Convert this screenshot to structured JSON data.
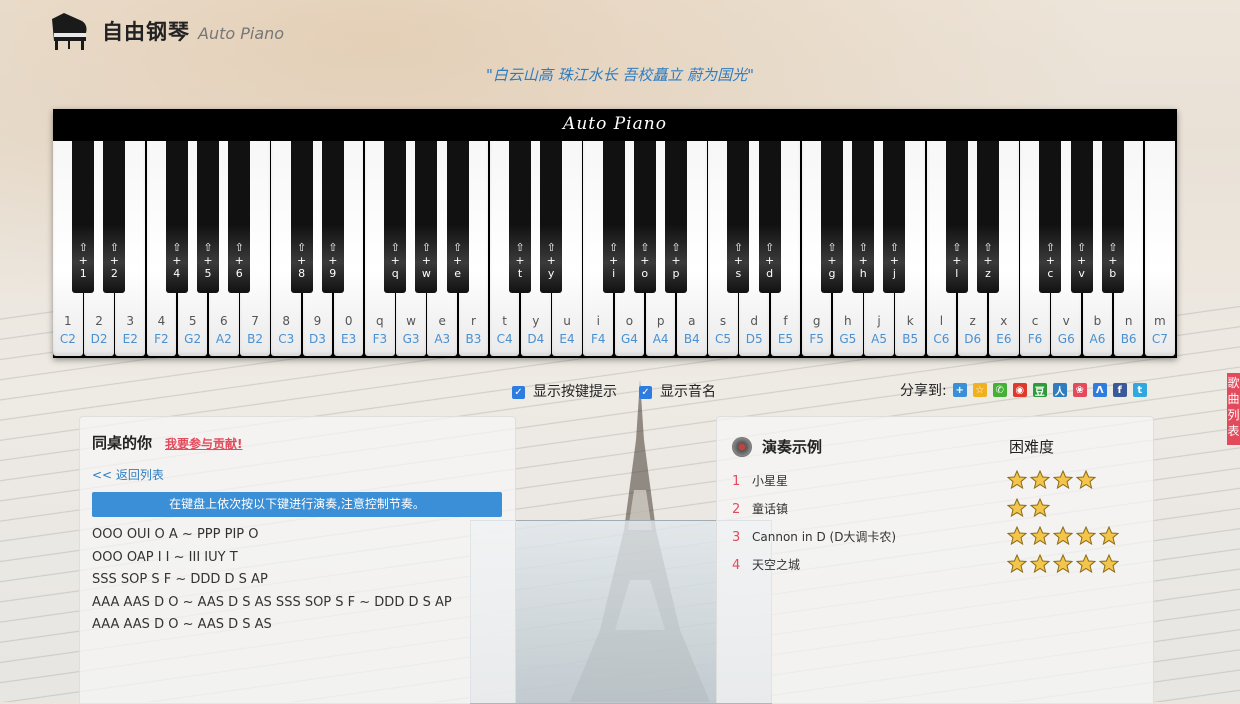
{
  "header": {
    "title": "自由钢琴",
    "subtitle": "Auto Piano",
    "motto": "\"白云山高 珠江水长 吾校矗立 蔚为国光\""
  },
  "piano": {
    "brand": "Auto Piano",
    "white_keys": [
      {
        "char": "1",
        "note": "C2"
      },
      {
        "char": "2",
        "note": "D2"
      },
      {
        "char": "3",
        "note": "E2"
      },
      {
        "char": "4",
        "note": "F2"
      },
      {
        "char": "5",
        "note": "G2"
      },
      {
        "char": "6",
        "note": "A2"
      },
      {
        "char": "7",
        "note": "B2"
      },
      {
        "char": "8",
        "note": "C3"
      },
      {
        "char": "9",
        "note": "D3"
      },
      {
        "char": "0",
        "note": "E3"
      },
      {
        "char": "q",
        "note": "F3"
      },
      {
        "char": "w",
        "note": "G3"
      },
      {
        "char": "e",
        "note": "A3"
      },
      {
        "char": "r",
        "note": "B3"
      },
      {
        "char": "t",
        "note": "C4"
      },
      {
        "char": "y",
        "note": "D4"
      },
      {
        "char": "u",
        "note": "E4"
      },
      {
        "char": "i",
        "note": "F4"
      },
      {
        "char": "o",
        "note": "G4"
      },
      {
        "char": "p",
        "note": "A4"
      },
      {
        "char": "a",
        "note": "B4"
      },
      {
        "char": "s",
        "note": "C5"
      },
      {
        "char": "d",
        "note": "D5"
      },
      {
        "char": "f",
        "note": "E5"
      },
      {
        "char": "g",
        "note": "F5"
      },
      {
        "char": "h",
        "note": "G5"
      },
      {
        "char": "j",
        "note": "A5"
      },
      {
        "char": "k",
        "note": "B5"
      },
      {
        "char": "l",
        "note": "C6"
      },
      {
        "char": "z",
        "note": "D6"
      },
      {
        "char": "x",
        "note": "E6"
      },
      {
        "char": "c",
        "note": "F6"
      },
      {
        "char": "v",
        "note": "G6"
      },
      {
        "char": "b",
        "note": "A6"
      },
      {
        "char": "n",
        "note": "B6"
      },
      {
        "char": "m",
        "note": "C7"
      }
    ],
    "black_keys": [
      {
        "char": "1",
        "after_white": 0
      },
      {
        "char": "2",
        "after_white": 1
      },
      {
        "char": "4",
        "after_white": 3
      },
      {
        "char": "5",
        "after_white": 4
      },
      {
        "char": "6",
        "after_white": 5
      },
      {
        "char": "8",
        "after_white": 7
      },
      {
        "char": "9",
        "after_white": 8
      },
      {
        "char": "q",
        "after_white": 10
      },
      {
        "char": "w",
        "after_white": 11
      },
      {
        "char": "e",
        "after_white": 12
      },
      {
        "char": "t",
        "after_white": 14
      },
      {
        "char": "y",
        "after_white": 15
      },
      {
        "char": "i",
        "after_white": 17
      },
      {
        "char": "o",
        "after_white": 18
      },
      {
        "char": "p",
        "after_white": 19
      },
      {
        "char": "s",
        "after_white": 21
      },
      {
        "char": "d",
        "after_white": 22
      },
      {
        "char": "g",
        "after_white": 24
      },
      {
        "char": "h",
        "after_white": 25
      },
      {
        "char": "j",
        "after_white": 26
      },
      {
        "char": "l",
        "after_white": 28
      },
      {
        "char": "z",
        "after_white": 29
      },
      {
        "char": "c",
        "after_white": 31
      },
      {
        "char": "v",
        "after_white": 32
      },
      {
        "char": "b",
        "after_white": 33
      }
    ],
    "shift_symbol": "⇧",
    "plus_symbol": "+"
  },
  "options": {
    "show_key_hints_label": "显示按键提示",
    "show_key_hints_checked": true,
    "show_note_names_label": "显示音名",
    "show_note_names_checked": true,
    "checkmark": "✓"
  },
  "share": {
    "label": "分享到:",
    "icons": [
      {
        "name": "plus-share-icon",
        "color": "#3a8fd6",
        "glyph": "+"
      },
      {
        "name": "favorite-star-icon",
        "color": "#f0b020",
        "glyph": "☆"
      },
      {
        "name": "wechat-icon",
        "color": "#45b035",
        "glyph": "✆"
      },
      {
        "name": "weibo-icon",
        "color": "#e0382a",
        "glyph": "◉"
      },
      {
        "name": "douban-icon",
        "color": "#2f9a3c",
        "glyph": "豆"
      },
      {
        "name": "renren-icon",
        "color": "#2f7cc0",
        "glyph": "人"
      },
      {
        "name": "flower-icon",
        "color": "#e34a5c",
        "glyph": "❀"
      },
      {
        "name": "qzone-icon",
        "color": "#2f7ce0",
        "glyph": "Λ"
      },
      {
        "name": "facebook-icon",
        "color": "#3b5998",
        "glyph": "f"
      },
      {
        "name": "twitter-icon",
        "color": "#2fa8e0",
        "glyph": "t"
      }
    ]
  },
  "side_tab": {
    "label": "歌曲列表"
  },
  "song": {
    "title": "同桌的你",
    "contribute_label": "我要参与贡献!",
    "back_label": "<< 返回列表",
    "instruction": "在键盘上依次按以下键进行演奏,注意控制节奏。",
    "score_lines": [
      "OOO OUI O A ~ PPP PIP O",
      "OOO OAP I I ~ III IUY T",
      "SSS SOP S F ~ DDD D S AP",
      "AAA AAS D O ~ AAS D S AS SSS SOP S F ~ DDD D S AP",
      "AAA AAS D O ~ AAS D S AS"
    ]
  },
  "examples": {
    "title": "演奏示例",
    "difficulty_header": "困难度",
    "items": [
      {
        "index": "1",
        "name": "小星星",
        "difficulty": 4
      },
      {
        "index": "2",
        "name": "童话镇",
        "difficulty": 2
      },
      {
        "index": "3",
        "name": "Cannon in D (D大调卡农)",
        "difficulty": 5
      },
      {
        "index": "4",
        "name": "天空之城",
        "difficulty": 5
      }
    ]
  }
}
